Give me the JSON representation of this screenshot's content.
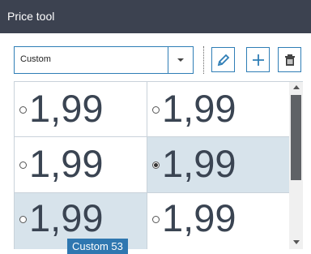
{
  "window": {
    "title": "Price tool"
  },
  "toolbar": {
    "dropdown_value": "Custom",
    "icons": {
      "dropdown": "chevron-down-icon",
      "edit": "pencil-icon",
      "add": "plus-icon",
      "delete": "trash-icon"
    }
  },
  "grid": {
    "cells": [
      {
        "price": "1,99",
        "selected": false,
        "shaded": false
      },
      {
        "price": "1,99",
        "selected": false,
        "shaded": false
      },
      {
        "price": "1,99",
        "selected": false,
        "shaded": false
      },
      {
        "price": "1,99",
        "selected": true,
        "shaded": true
      },
      {
        "price": "1,99",
        "selected": false,
        "shaded": true
      },
      {
        "price": "1,99",
        "selected": false,
        "shaded": false
      }
    ]
  },
  "tooltip": {
    "text": "Custom 53"
  },
  "colors": {
    "titlebar": "#3c4250",
    "accent": "#2f7eb6",
    "selected_cell": "#d7e3eb",
    "tooltip": "#2f77b0"
  }
}
